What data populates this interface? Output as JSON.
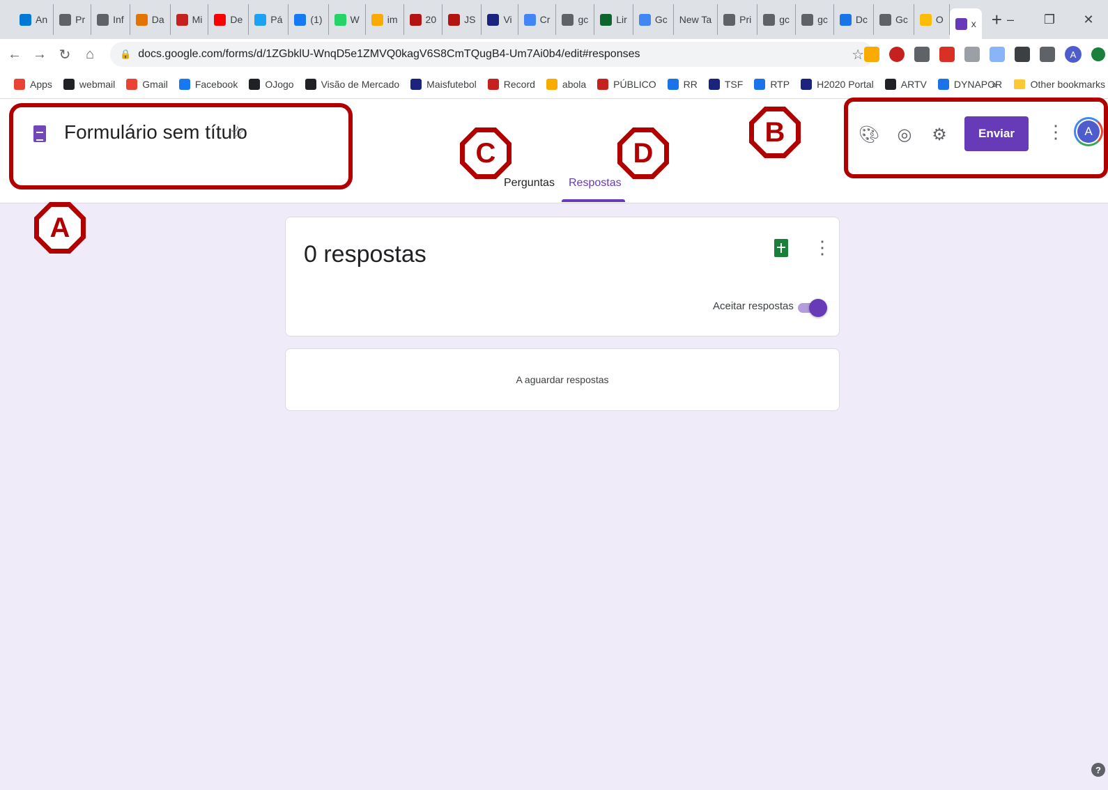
{
  "browser": {
    "tabs": [
      {
        "label": "An",
        "icon": "outlook-icon",
        "color": "#0078d4"
      },
      {
        "label": "Pr",
        "icon": "globe-icon",
        "color": "#5f6368"
      },
      {
        "label": "Inf",
        "icon": "globe-icon",
        "color": "#5f6368"
      },
      {
        "label": "Da",
        "icon": "app-icon",
        "color": "#e37400"
      },
      {
        "label": "Mi",
        "icon": "app-icon",
        "color": "#c5221f"
      },
      {
        "label": "De",
        "icon": "youtube-icon",
        "color": "#ff0000"
      },
      {
        "label": "Pá",
        "icon": "twitter-icon",
        "color": "#1da1f2"
      },
      {
        "label": "(1)",
        "icon": "facebook-icon",
        "color": "#1877f2"
      },
      {
        "label": "W",
        "icon": "whatsapp-icon",
        "color": "#25d366"
      },
      {
        "label": "im",
        "icon": "app-icon",
        "color": "#f9ab00"
      },
      {
        "label": "20",
        "icon": "shield-icon",
        "color": "#b31412"
      },
      {
        "label": "JS",
        "icon": "shield-icon",
        "color": "#b31412"
      },
      {
        "label": "Vi",
        "icon": "xm-icon",
        "color": "#1a237e"
      },
      {
        "label": "Cr",
        "icon": "google-icon",
        "color": "#4285f4"
      },
      {
        "label": "gc",
        "icon": "globe-icon",
        "color": "#5f6368"
      },
      {
        "label": "Lir",
        "icon": "app-icon",
        "color": "#0d652d"
      },
      {
        "label": "Gc",
        "icon": "docs-icon",
        "color": "#4285f4"
      },
      {
        "label": "New Ta",
        "icon": "",
        "color": ""
      },
      {
        "label": "Pri",
        "icon": "globe-icon",
        "color": "#5f6368"
      },
      {
        "label": "gc",
        "icon": "globe-icon",
        "color": "#5f6368"
      },
      {
        "label": "gc",
        "icon": "globe-icon",
        "color": "#5f6368"
      },
      {
        "label": "Dc",
        "icon": "download-icon",
        "color": "#1a73e8"
      },
      {
        "label": "Gc",
        "icon": "globe-icon",
        "color": "#5f6368"
      },
      {
        "label": "O",
        "icon": "drive-icon",
        "color": "#fbbc04"
      }
    ],
    "active_tab": {
      "label": "x",
      "icon": "forms-icon",
      "color": "#673ab7"
    },
    "new_tab": "+",
    "window_controls": [
      "–",
      "❐",
      "✕"
    ],
    "url": "docs.google.com/forms/d/1ZGbklU-WnqD5e1ZMVQ0kagV6S8CmTQugB4-Um7Ai0b4/edit#responses",
    "bookmarks": [
      {
        "label": "Apps",
        "color": "#ea4335"
      },
      {
        "label": "webmail",
        "color": "#202124"
      },
      {
        "label": "Gmail",
        "color": "#ea4335"
      },
      {
        "label": "Facebook",
        "color": "#1877f2"
      },
      {
        "label": "OJogo",
        "color": "#202124"
      },
      {
        "label": "Visão de Mercado",
        "color": "#202124"
      },
      {
        "label": "Maisfutebol",
        "color": "#1a237e"
      },
      {
        "label": "Record",
        "color": "#c5221f"
      },
      {
        "label": "abola",
        "color": "#f9ab00"
      },
      {
        "label": "PÚBLICO",
        "color": "#c5221f"
      },
      {
        "label": "RR",
        "color": "#1a73e8"
      },
      {
        "label": "TSF",
        "color": "#1a237e"
      },
      {
        "label": "RTP",
        "color": "#1a73e8"
      },
      {
        "label": "H2020 Portal",
        "color": "#1a237e"
      },
      {
        "label": "ARTV",
        "color": "#202124"
      },
      {
        "label": "DYNAPOR",
        "color": "#1a73e8"
      }
    ],
    "bookmarks_overflow": "»",
    "other_bookmarks": "Other bookmarks",
    "avatar_letter": "A"
  },
  "form": {
    "title": "Formulário sem título",
    "tabs": {
      "questions": "Perguntas",
      "responses": "Respostas"
    },
    "send_label": "Enviar",
    "user_initial": "A",
    "accent": "#673ab7"
  },
  "responses": {
    "count_text": "0 respostas",
    "accept_label": "Aceitar respostas",
    "accepting": true,
    "waiting_text": "A aguardar respostas"
  },
  "annotations": {
    "a": "A",
    "b": "B",
    "c": "C",
    "d": "D"
  },
  "help": "?"
}
